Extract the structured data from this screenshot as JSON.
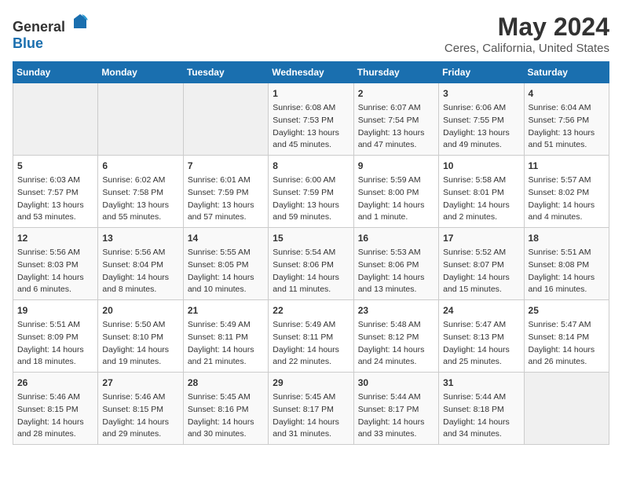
{
  "header": {
    "logo_general": "General",
    "logo_blue": "Blue",
    "title": "May 2024",
    "subtitle": "Ceres, California, United States"
  },
  "days_of_week": [
    "Sunday",
    "Monday",
    "Tuesday",
    "Wednesday",
    "Thursday",
    "Friday",
    "Saturday"
  ],
  "weeks": [
    [
      {
        "day": "",
        "content": ""
      },
      {
        "day": "",
        "content": ""
      },
      {
        "day": "",
        "content": ""
      },
      {
        "day": "1",
        "content": "Sunrise: 6:08 AM\nSunset: 7:53 PM\nDaylight: 13 hours\nand 45 minutes."
      },
      {
        "day": "2",
        "content": "Sunrise: 6:07 AM\nSunset: 7:54 PM\nDaylight: 13 hours\nand 47 minutes."
      },
      {
        "day": "3",
        "content": "Sunrise: 6:06 AM\nSunset: 7:55 PM\nDaylight: 13 hours\nand 49 minutes."
      },
      {
        "day": "4",
        "content": "Sunrise: 6:04 AM\nSunset: 7:56 PM\nDaylight: 13 hours\nand 51 minutes."
      }
    ],
    [
      {
        "day": "5",
        "content": "Sunrise: 6:03 AM\nSunset: 7:57 PM\nDaylight: 13 hours\nand 53 minutes."
      },
      {
        "day": "6",
        "content": "Sunrise: 6:02 AM\nSunset: 7:58 PM\nDaylight: 13 hours\nand 55 minutes."
      },
      {
        "day": "7",
        "content": "Sunrise: 6:01 AM\nSunset: 7:59 PM\nDaylight: 13 hours\nand 57 minutes."
      },
      {
        "day": "8",
        "content": "Sunrise: 6:00 AM\nSunset: 7:59 PM\nDaylight: 13 hours\nand 59 minutes."
      },
      {
        "day": "9",
        "content": "Sunrise: 5:59 AM\nSunset: 8:00 PM\nDaylight: 14 hours\nand 1 minute."
      },
      {
        "day": "10",
        "content": "Sunrise: 5:58 AM\nSunset: 8:01 PM\nDaylight: 14 hours\nand 2 minutes."
      },
      {
        "day": "11",
        "content": "Sunrise: 5:57 AM\nSunset: 8:02 PM\nDaylight: 14 hours\nand 4 minutes."
      }
    ],
    [
      {
        "day": "12",
        "content": "Sunrise: 5:56 AM\nSunset: 8:03 PM\nDaylight: 14 hours\nand 6 minutes."
      },
      {
        "day": "13",
        "content": "Sunrise: 5:56 AM\nSunset: 8:04 PM\nDaylight: 14 hours\nand 8 minutes."
      },
      {
        "day": "14",
        "content": "Sunrise: 5:55 AM\nSunset: 8:05 PM\nDaylight: 14 hours\nand 10 minutes."
      },
      {
        "day": "15",
        "content": "Sunrise: 5:54 AM\nSunset: 8:06 PM\nDaylight: 14 hours\nand 11 minutes."
      },
      {
        "day": "16",
        "content": "Sunrise: 5:53 AM\nSunset: 8:06 PM\nDaylight: 14 hours\nand 13 minutes."
      },
      {
        "day": "17",
        "content": "Sunrise: 5:52 AM\nSunset: 8:07 PM\nDaylight: 14 hours\nand 15 minutes."
      },
      {
        "day": "18",
        "content": "Sunrise: 5:51 AM\nSunset: 8:08 PM\nDaylight: 14 hours\nand 16 minutes."
      }
    ],
    [
      {
        "day": "19",
        "content": "Sunrise: 5:51 AM\nSunset: 8:09 PM\nDaylight: 14 hours\nand 18 minutes."
      },
      {
        "day": "20",
        "content": "Sunrise: 5:50 AM\nSunset: 8:10 PM\nDaylight: 14 hours\nand 19 minutes."
      },
      {
        "day": "21",
        "content": "Sunrise: 5:49 AM\nSunset: 8:11 PM\nDaylight: 14 hours\nand 21 minutes."
      },
      {
        "day": "22",
        "content": "Sunrise: 5:49 AM\nSunset: 8:11 PM\nDaylight: 14 hours\nand 22 minutes."
      },
      {
        "day": "23",
        "content": "Sunrise: 5:48 AM\nSunset: 8:12 PM\nDaylight: 14 hours\nand 24 minutes."
      },
      {
        "day": "24",
        "content": "Sunrise: 5:47 AM\nSunset: 8:13 PM\nDaylight: 14 hours\nand 25 minutes."
      },
      {
        "day": "25",
        "content": "Sunrise: 5:47 AM\nSunset: 8:14 PM\nDaylight: 14 hours\nand 26 minutes."
      }
    ],
    [
      {
        "day": "26",
        "content": "Sunrise: 5:46 AM\nSunset: 8:15 PM\nDaylight: 14 hours\nand 28 minutes."
      },
      {
        "day": "27",
        "content": "Sunrise: 5:46 AM\nSunset: 8:15 PM\nDaylight: 14 hours\nand 29 minutes."
      },
      {
        "day": "28",
        "content": "Sunrise: 5:45 AM\nSunset: 8:16 PM\nDaylight: 14 hours\nand 30 minutes."
      },
      {
        "day": "29",
        "content": "Sunrise: 5:45 AM\nSunset: 8:17 PM\nDaylight: 14 hours\nand 31 minutes."
      },
      {
        "day": "30",
        "content": "Sunrise: 5:44 AM\nSunset: 8:17 PM\nDaylight: 14 hours\nand 33 minutes."
      },
      {
        "day": "31",
        "content": "Sunrise: 5:44 AM\nSunset: 8:18 PM\nDaylight: 14 hours\nand 34 minutes."
      },
      {
        "day": "",
        "content": ""
      }
    ]
  ]
}
